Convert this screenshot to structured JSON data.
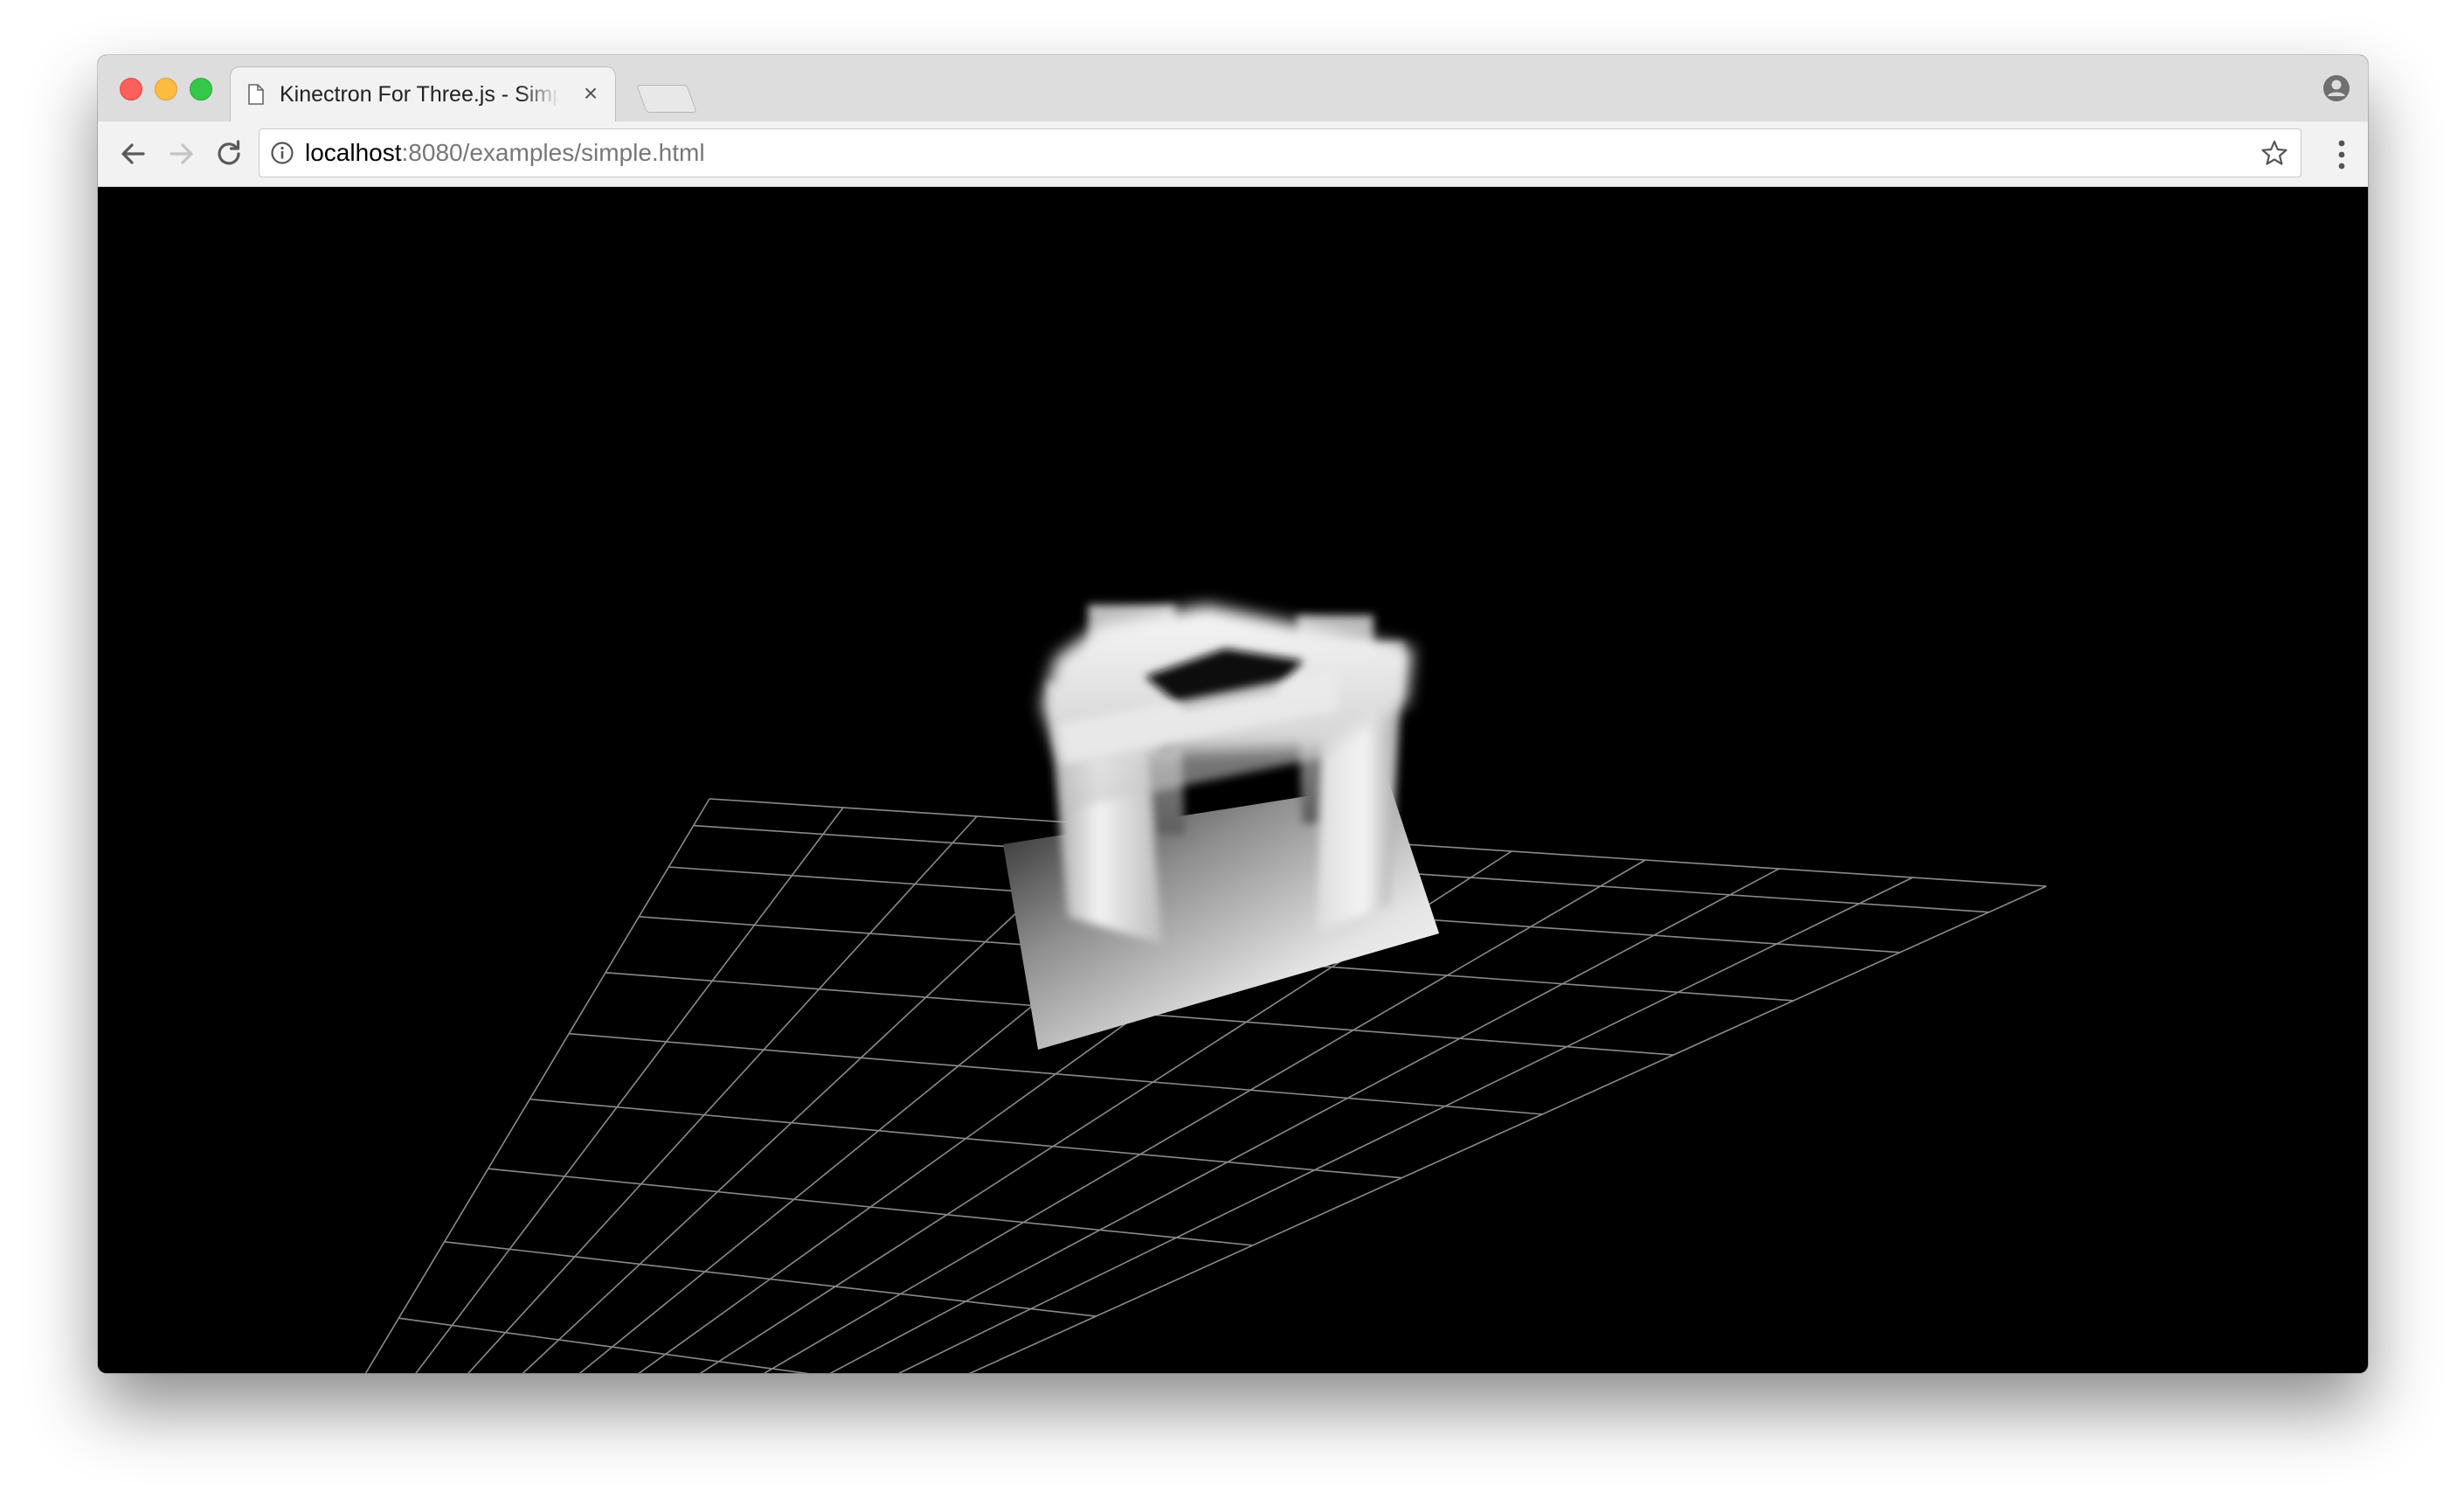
{
  "browser": {
    "tab": {
      "title": "Kinectron For Three.js - Simple",
      "favicon": "page-icon",
      "close_icon": "close-icon"
    },
    "address_bar": {
      "host": "localhost",
      "rest": ":8080/examples/simple.html",
      "security_icon": "info-icon",
      "bookmark_icon": "star-icon"
    },
    "nav": {
      "back_icon": "back-arrow-icon",
      "forward_icon": "forward-arrow-icon",
      "reload_icon": "reload-icon"
    },
    "menu_icon": "vertical-dots-icon",
    "profile_icon": "profile-icon"
  },
  "scene": {
    "background": "#000000",
    "grid_color": "#8a8a8a",
    "grid_divisions": 10,
    "object": "white-hollow-cube"
  }
}
